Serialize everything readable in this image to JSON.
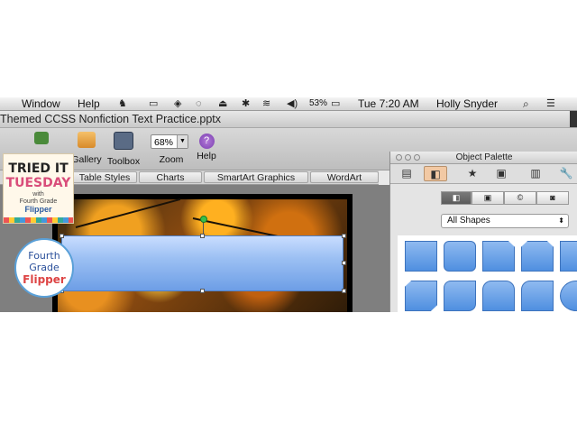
{
  "menubar": {
    "items": [
      "Window",
      "Help"
    ],
    "battery": "53%",
    "clock": "Tue 7:20 AM",
    "user": "Holly Snyder"
  },
  "window": {
    "title": "Themed CCSS Nonfiction Text Practice.pptx"
  },
  "toolbar": {
    "gallery_label": "Gallery",
    "toolbox_label": "Toolbox",
    "zoom_label": "Zoom",
    "zoom_value": "68%",
    "help_label": "Help"
  },
  "ribbon": {
    "tabs": [
      "Table Styles",
      "Charts",
      "SmartArt Graphics",
      "WordArt"
    ]
  },
  "palette": {
    "title": "Object Palette",
    "shapes_filter": "All Shapes"
  },
  "badges": {
    "tried_it": "TRIED IT",
    "tuesday": "TUESDAY",
    "with": "with",
    "fourth_grade": "Fourth Grade",
    "flipper": "Flipper",
    "circle_line1": "Fourth",
    "circle_line2": "Grade",
    "circle_line3": "Flipper"
  },
  "colors": {
    "accent_blue": "#6d9ee6",
    "palette_active_tab": "#f2c9a4",
    "rotation_handle": "#39c04a"
  }
}
